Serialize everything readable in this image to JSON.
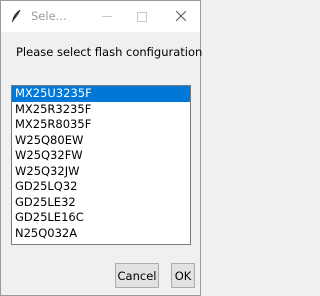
{
  "window": {
    "title": "Sele...",
    "icon": "feather-icon"
  },
  "dialog": {
    "prompt": "Please select flash configuration"
  },
  "list": {
    "selected_index": 0,
    "items": [
      "MX25U3235F",
      "MX25R3235F",
      "MX25R8035F",
      "W25Q80EW",
      "W25Q32FW",
      "W25Q32JW",
      "GD25LQ32",
      "GD25LE32",
      "GD25LE16C",
      "N25Q032A"
    ]
  },
  "buttons": {
    "cancel": "Cancel",
    "ok": "OK"
  },
  "colors": {
    "selection": "#0078d7",
    "background": "#f0f0f0"
  }
}
